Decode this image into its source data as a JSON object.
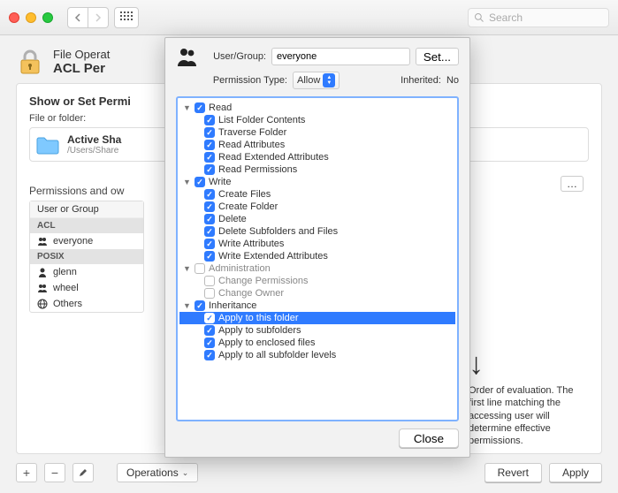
{
  "toolbar": {
    "search_placeholder": "Search"
  },
  "header": {
    "line1": "File Operat",
    "line2": "ACL Per"
  },
  "panel": {
    "title": "Show or Set Permi",
    "file_label": "File or folder:",
    "active_name": "Active Sha",
    "active_path": "/Users/Share",
    "perm_heading": "Permissions and ow",
    "list_header": "User or Group",
    "group_acl": "ACL",
    "row_everyone": "everyone",
    "group_posix": "POSIX",
    "row_glenn": "glenn",
    "row_wheel": "wheel",
    "row_others": "Others"
  },
  "eval": {
    "title": "Order of evaluation.",
    "text": "The first line matching the accessing user will determine effective permissions."
  },
  "bottom": {
    "operations": "Operations",
    "revert": "Revert",
    "apply": "Apply"
  },
  "sheet": {
    "user_group_label": "User/Group:",
    "user_group_value": "everyone",
    "set_label": "Set...",
    "perm_type_label": "Permission Type:",
    "perm_type_value": "Allow",
    "inherited_label": "Inherited:",
    "inherited_value": "No",
    "close": "Close",
    "tree": {
      "read": "Read",
      "list_folder": "List Folder Contents",
      "traverse": "Traverse Folder",
      "read_attr": "Read Attributes",
      "read_ext_attr": "Read Extended Attributes",
      "read_perm": "Read Permissions",
      "write": "Write",
      "create_files": "Create Files",
      "create_folder": "Create Folder",
      "delete": "Delete",
      "delete_sub": "Delete Subfolders and Files",
      "write_attr": "Write Attributes",
      "write_ext_attr": "Write Extended Attributes",
      "admin": "Administration",
      "change_perm": "Change Permissions",
      "change_owner": "Change Owner",
      "inherit": "Inheritance",
      "apply_folder": "Apply to this folder",
      "apply_subfolders": "Apply to subfolders",
      "apply_enclosed": "Apply to enclosed files",
      "apply_all_levels": "Apply to all subfolder levels"
    }
  }
}
